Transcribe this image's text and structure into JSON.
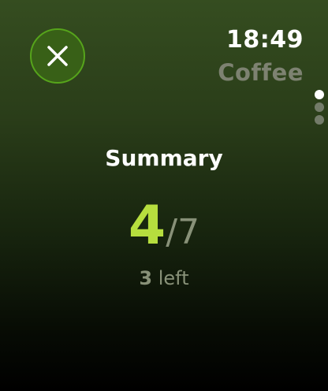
{
  "header": {
    "time": "18:49",
    "app_name": "Coffee",
    "close_icon": "close-icon"
  },
  "pager": {
    "total_pages": 3,
    "current_page": 1
  },
  "summary": {
    "title": "Summary",
    "completed": "4",
    "separator": "/",
    "total": "7",
    "remaining_count": "3",
    "remaining_label": "left"
  },
  "colors": {
    "accent": "#b6de3e",
    "close_button_fill": "#386017",
    "close_button_ring": "#56a41b",
    "secondary_text": "#889178",
    "app_name_text": "#7d8271"
  }
}
